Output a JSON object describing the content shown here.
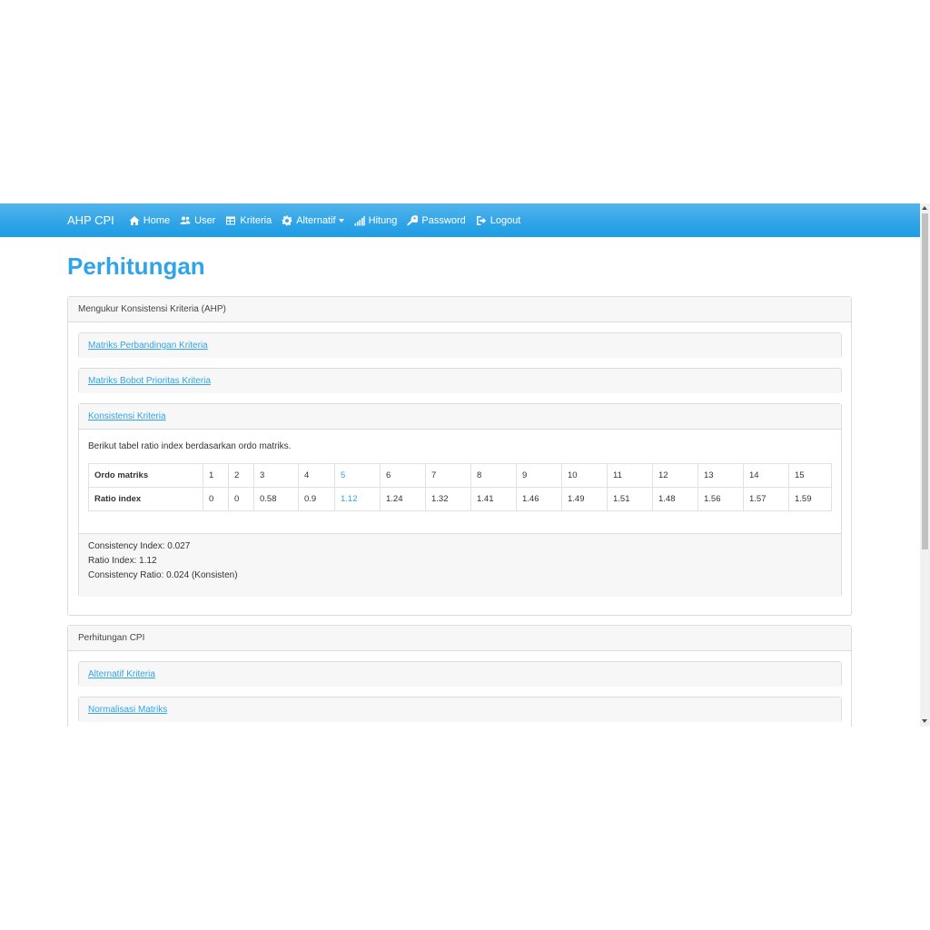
{
  "navbar": {
    "brand": "AHP CPI",
    "items": [
      {
        "label": "Home",
        "icon": "home-icon"
      },
      {
        "label": "User",
        "icon": "users-icon"
      },
      {
        "label": "Kriteria",
        "icon": "table-icon"
      },
      {
        "label": "Alternatif",
        "icon": "gear-icon"
      },
      {
        "label": "Hitung",
        "icon": "signal-icon"
      },
      {
        "label": "Password",
        "icon": "key-icon"
      },
      {
        "label": "Logout",
        "icon": "sign-out-icon"
      }
    ]
  },
  "page": {
    "title": "Perhitungan"
  },
  "ahp_card": {
    "header": "Mengukur Konsistensi Kriteria (AHP)",
    "sections": [
      {
        "label": "Matriks Perbandingan Kriteria"
      },
      {
        "label": "Matriks Bobot Prioritas Kriteria"
      },
      {
        "label": "Konsistensi Kriteria"
      }
    ],
    "intro": "Berikut tabel ratio index berdasarkan ordo matriks.",
    "table": {
      "row1_label": "Ordo matriks",
      "row2_label": "Ratio index",
      "ordo": [
        "1",
        "2",
        "3",
        "4",
        "5",
        "6",
        "7",
        "8",
        "9",
        "10",
        "11",
        "12",
        "13",
        "14",
        "15"
      ],
      "ratio": [
        "0",
        "0",
        "0.58",
        "0.9",
        "1.12",
        "1.24",
        "1.32",
        "1.41",
        "1.46",
        "1.49",
        "1.51",
        "1.48",
        "1.56",
        "1.57",
        "1.59"
      ]
    },
    "results": {
      "ci": "Consistency Index: 0.027",
      "ri": "Ratio Index: 1.12",
      "cr": "Consistency Ratio: 0.024 (Konsisten)"
    }
  },
  "cpi_card": {
    "header": "Perhitungan CPI",
    "sections": [
      {
        "label": "Alternatif Kriteria"
      },
      {
        "label": "Normalisasi Matriks"
      }
    ]
  },
  "colors": {
    "primary": "#2fa4e7",
    "header_bg": "#f7f7f7",
    "border": "#dcdcdc"
  }
}
